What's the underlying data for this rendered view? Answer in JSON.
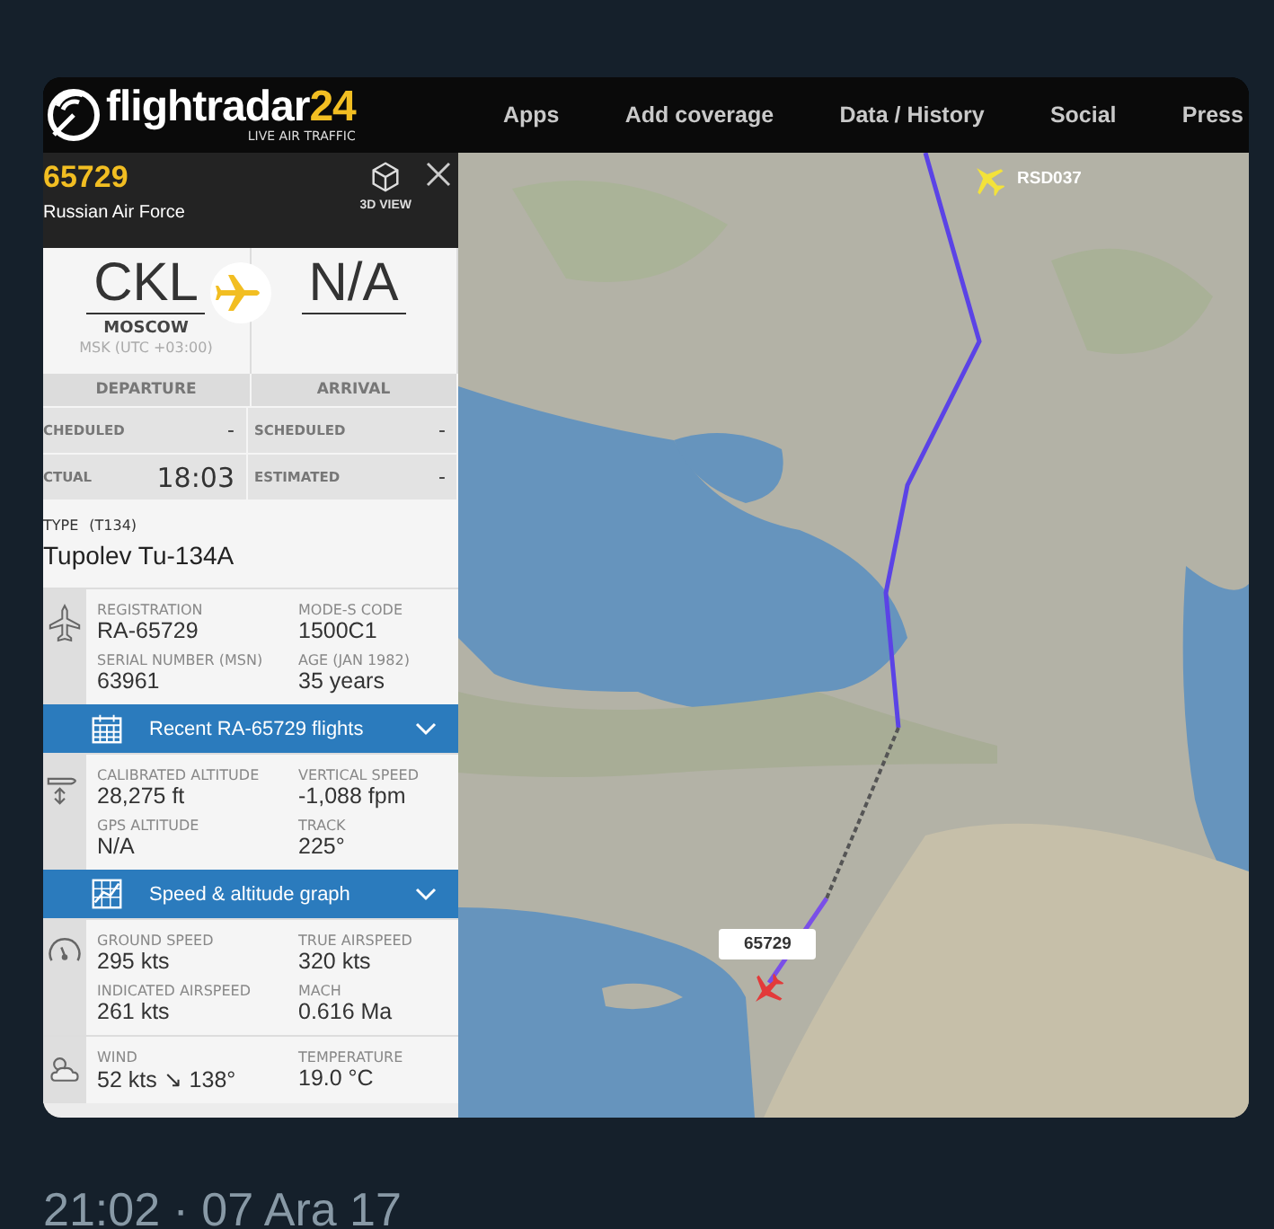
{
  "app": {
    "logo": "flightradar",
    "logo_accent": "24",
    "tagline": "LIVE AIR TRAFFIC",
    "nav": [
      "Apps",
      "Add coverage",
      "Data / History",
      "Social",
      "Press"
    ]
  },
  "flight": {
    "callsign": "65729",
    "operator": "Russian Air Force",
    "view_button": "3D VIEW"
  },
  "origin": {
    "code": "CKL",
    "city": "MOSCOW",
    "timezone": "MSK (UTC +03:00)"
  },
  "destination": {
    "code": "N/A"
  },
  "times": {
    "headers": [
      "DEPARTURE",
      "ARRIVAL"
    ],
    "rows": [
      {
        "left_label": "CHEDULED",
        "left_value": "-",
        "right_label": "SCHEDULED",
        "right_value": "-"
      },
      {
        "left_label": "CTUAL",
        "left_value": "18:03",
        "right_label": "ESTIMATED",
        "right_value": "-"
      }
    ]
  },
  "aircraft": {
    "type_label": "TYPE",
    "type_code": "(T134)",
    "type_name": "Tupolev Tu-134A"
  },
  "sections": [
    {
      "kind": "fields",
      "fields": [
        {
          "label": "REGISTRATION",
          "value": "RA-65729"
        },
        {
          "label": "MODE-S CODE",
          "value": "1500C1"
        },
        {
          "label": "SERIAL NUMBER (MSN)",
          "value": "63961"
        },
        {
          "label": "AGE (JAN 1982)",
          "value": "35 years"
        }
      ]
    },
    {
      "kind": "bar",
      "label": "Recent RA-65729 flights"
    },
    {
      "kind": "fields",
      "fields": [
        {
          "label": "CALIBRATED ALTITUDE",
          "value": "28,275 ft"
        },
        {
          "label": "VERTICAL SPEED",
          "value": "-1,088 fpm"
        },
        {
          "label": "GPS ALTITUDE",
          "value": "N/A"
        },
        {
          "label": "TRACK",
          "value": "225°"
        }
      ]
    },
    {
      "kind": "bar",
      "label": "Speed & altitude graph"
    },
    {
      "kind": "fields",
      "fields": [
        {
          "label": "GROUND SPEED",
          "value": "295 kts"
        },
        {
          "label": "TRUE AIRSPEED",
          "value": "320 kts"
        },
        {
          "label": "INDICATED AIRSPEED",
          "value": "261 kts"
        },
        {
          "label": "MACH",
          "value": "0.616 Ma"
        }
      ]
    },
    {
      "kind": "fields",
      "fields": [
        {
          "label": "WIND",
          "value": "52 kts ↘ 138°"
        },
        {
          "label": "TEMPERATURE",
          "value": "19.0 °C"
        }
      ]
    }
  ],
  "map": {
    "kind": "picture",
    "flights": [
      {
        "callsign": "RSD037",
        "selected": false
      },
      {
        "callsign": "65729",
        "selected": true
      }
    ]
  },
  "timestamp": "21:02 · 07 Ara 17"
}
